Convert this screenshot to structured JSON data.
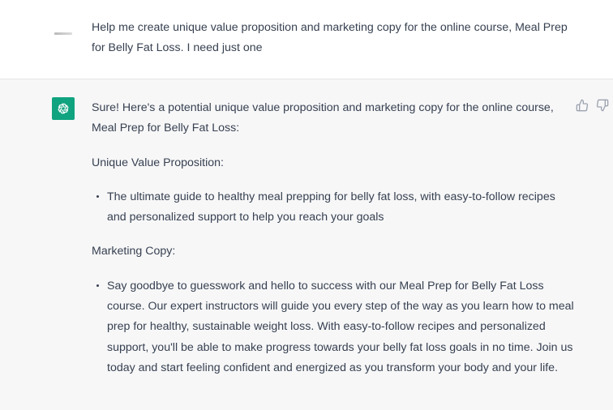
{
  "user_message": {
    "text": "Help me create unique value proposition and marketing copy for the online course, Meal Prep for Belly Fat Loss. I need just one"
  },
  "assistant_message": {
    "intro": "Sure! Here's a potential unique value proposition and marketing copy for the online course, Meal Prep for Belly Fat Loss:",
    "uvp_heading": "Unique Value Proposition:",
    "uvp_items": [
      "The ultimate guide to healthy meal prepping for belly fat loss, with easy-to-follow recipes and personalized support to help you reach your goals"
    ],
    "marketing_heading": "Marketing Copy:",
    "marketing_items": [
      "Say goodbye to guesswork and hello to success with our Meal Prep for Belly Fat Loss course. Our expert instructors will guide you every step of the way as you learn how to meal prep for healthy, sustainable weight loss. With easy-to-follow recipes and personalized support, you'll be able to make progress towards your belly fat loss goals in no time. Join us today and start feeling confident and energized as you transform your body and your life."
    ]
  },
  "icons": {
    "assistant_avatar": "openai-logo-icon",
    "thumbs_up": "thumbs-up-icon",
    "thumbs_down": "thumbs-down-icon"
  },
  "colors": {
    "assistant_avatar_bg": "#10a37f",
    "assistant_row_bg": "#f7f7f8",
    "text": "#374151"
  }
}
